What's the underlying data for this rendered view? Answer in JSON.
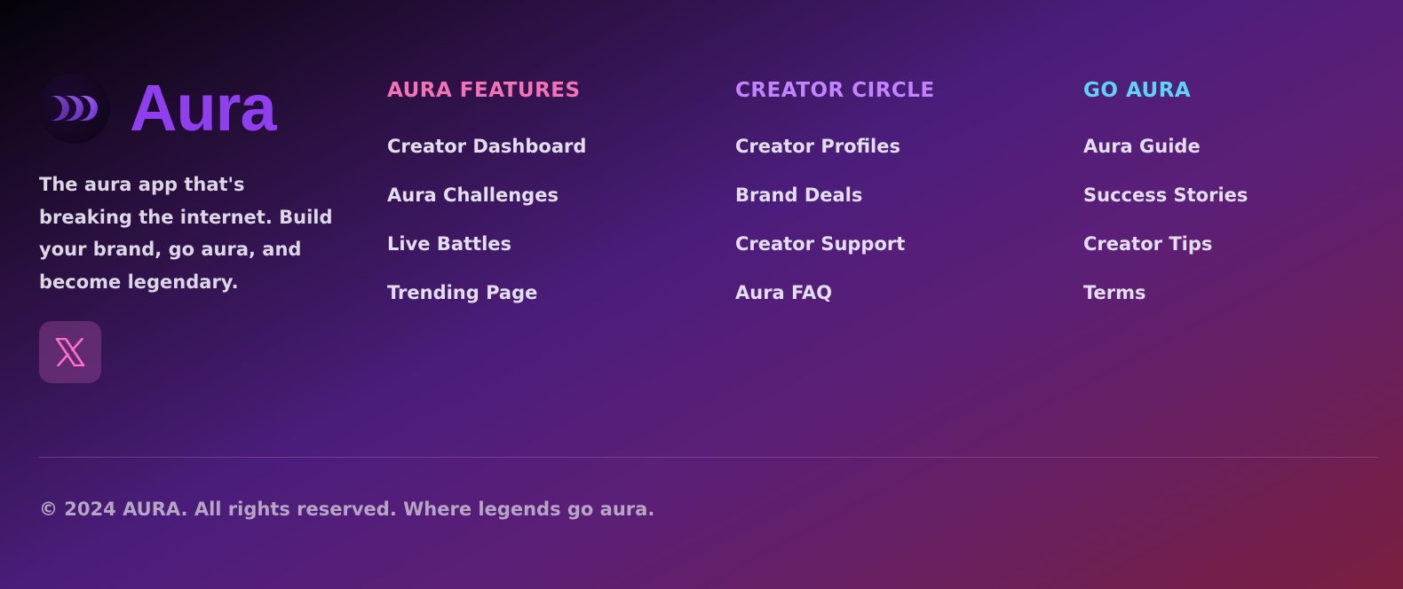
{
  "brand": {
    "name": "Aura",
    "tagline": "The aura app that's breaking the internet. Build your brand, go aura, and become legendary.",
    "logo_icon": "triple-chevron-circle-icon",
    "name_color": "#8f3ff0"
  },
  "social": {
    "icon": "x-logo-icon",
    "icon_color": "#ff6ec7"
  },
  "columns": [
    {
      "title": "AURA FEATURES",
      "title_color": "#f472b6",
      "links": [
        "Creator Dashboard",
        "Aura Challenges",
        "Live Battles",
        "Trending Page"
      ]
    },
    {
      "title": "CREATOR CIRCLE",
      "title_color": "#c084fc",
      "links": [
        "Creator Profiles",
        "Brand Deals",
        "Creator Support",
        "Aura FAQ"
      ]
    },
    {
      "title": "GO AURA",
      "title_color": "#5ed3f3",
      "links": [
        "Aura Guide",
        "Success Stories",
        "Creator Tips",
        "Terms"
      ]
    }
  ],
  "copyright": "© 2024 AURA. All rights reserved. Where legends go aura."
}
